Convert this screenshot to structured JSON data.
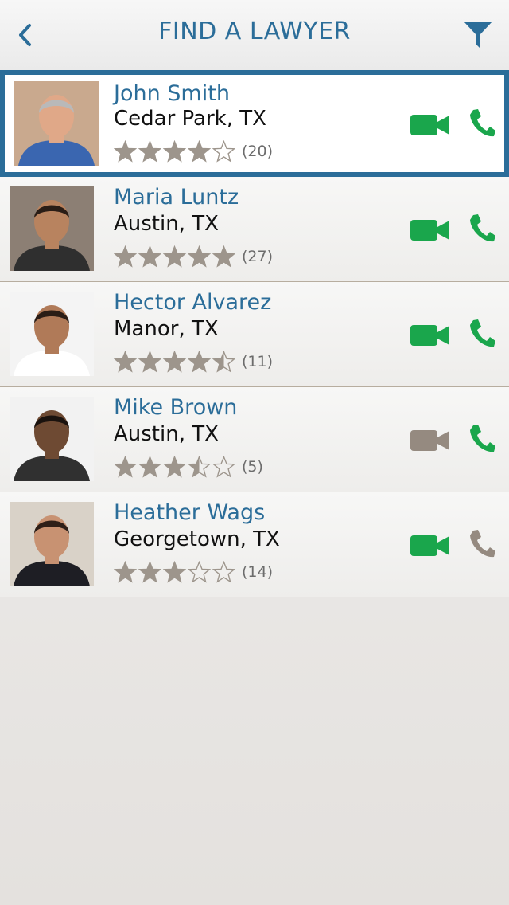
{
  "header": {
    "title": "FIND A LAWYER",
    "back_icon": "chevron-left-icon",
    "filter_icon": "filter-icon"
  },
  "colors": {
    "brand_blue": "#2b6d99",
    "video_active": "#1aa64c",
    "video_inactive": "#958a80",
    "phone_active": "#1aa64c",
    "phone_inactive": "#958a80",
    "star_color": "#9d958c"
  },
  "lawyers": [
    {
      "name": "John Smith",
      "city": "Cedar Park, TX",
      "rating": 4.0,
      "reviews": "(20)",
      "video_available": true,
      "phone_available": true,
      "selected": true
    },
    {
      "name": "Maria Luntz",
      "city": "Austin, TX",
      "rating": 5.0,
      "reviews": "(27)",
      "video_available": true,
      "phone_available": true,
      "selected": false
    },
    {
      "name": "Hector Alvarez",
      "city": "Manor, TX",
      "rating": 4.5,
      "reviews": "(11)",
      "video_available": true,
      "phone_available": true,
      "selected": false
    },
    {
      "name": "Mike Brown",
      "city": "Austin, TX",
      "rating": 3.5,
      "reviews": "(5)",
      "video_available": false,
      "phone_available": true,
      "selected": false
    },
    {
      "name": "Heather Wags",
      "city": "Georgetown, TX",
      "rating": 3.0,
      "reviews": "(14)",
      "video_available": true,
      "phone_available": false,
      "selected": false
    }
  ]
}
